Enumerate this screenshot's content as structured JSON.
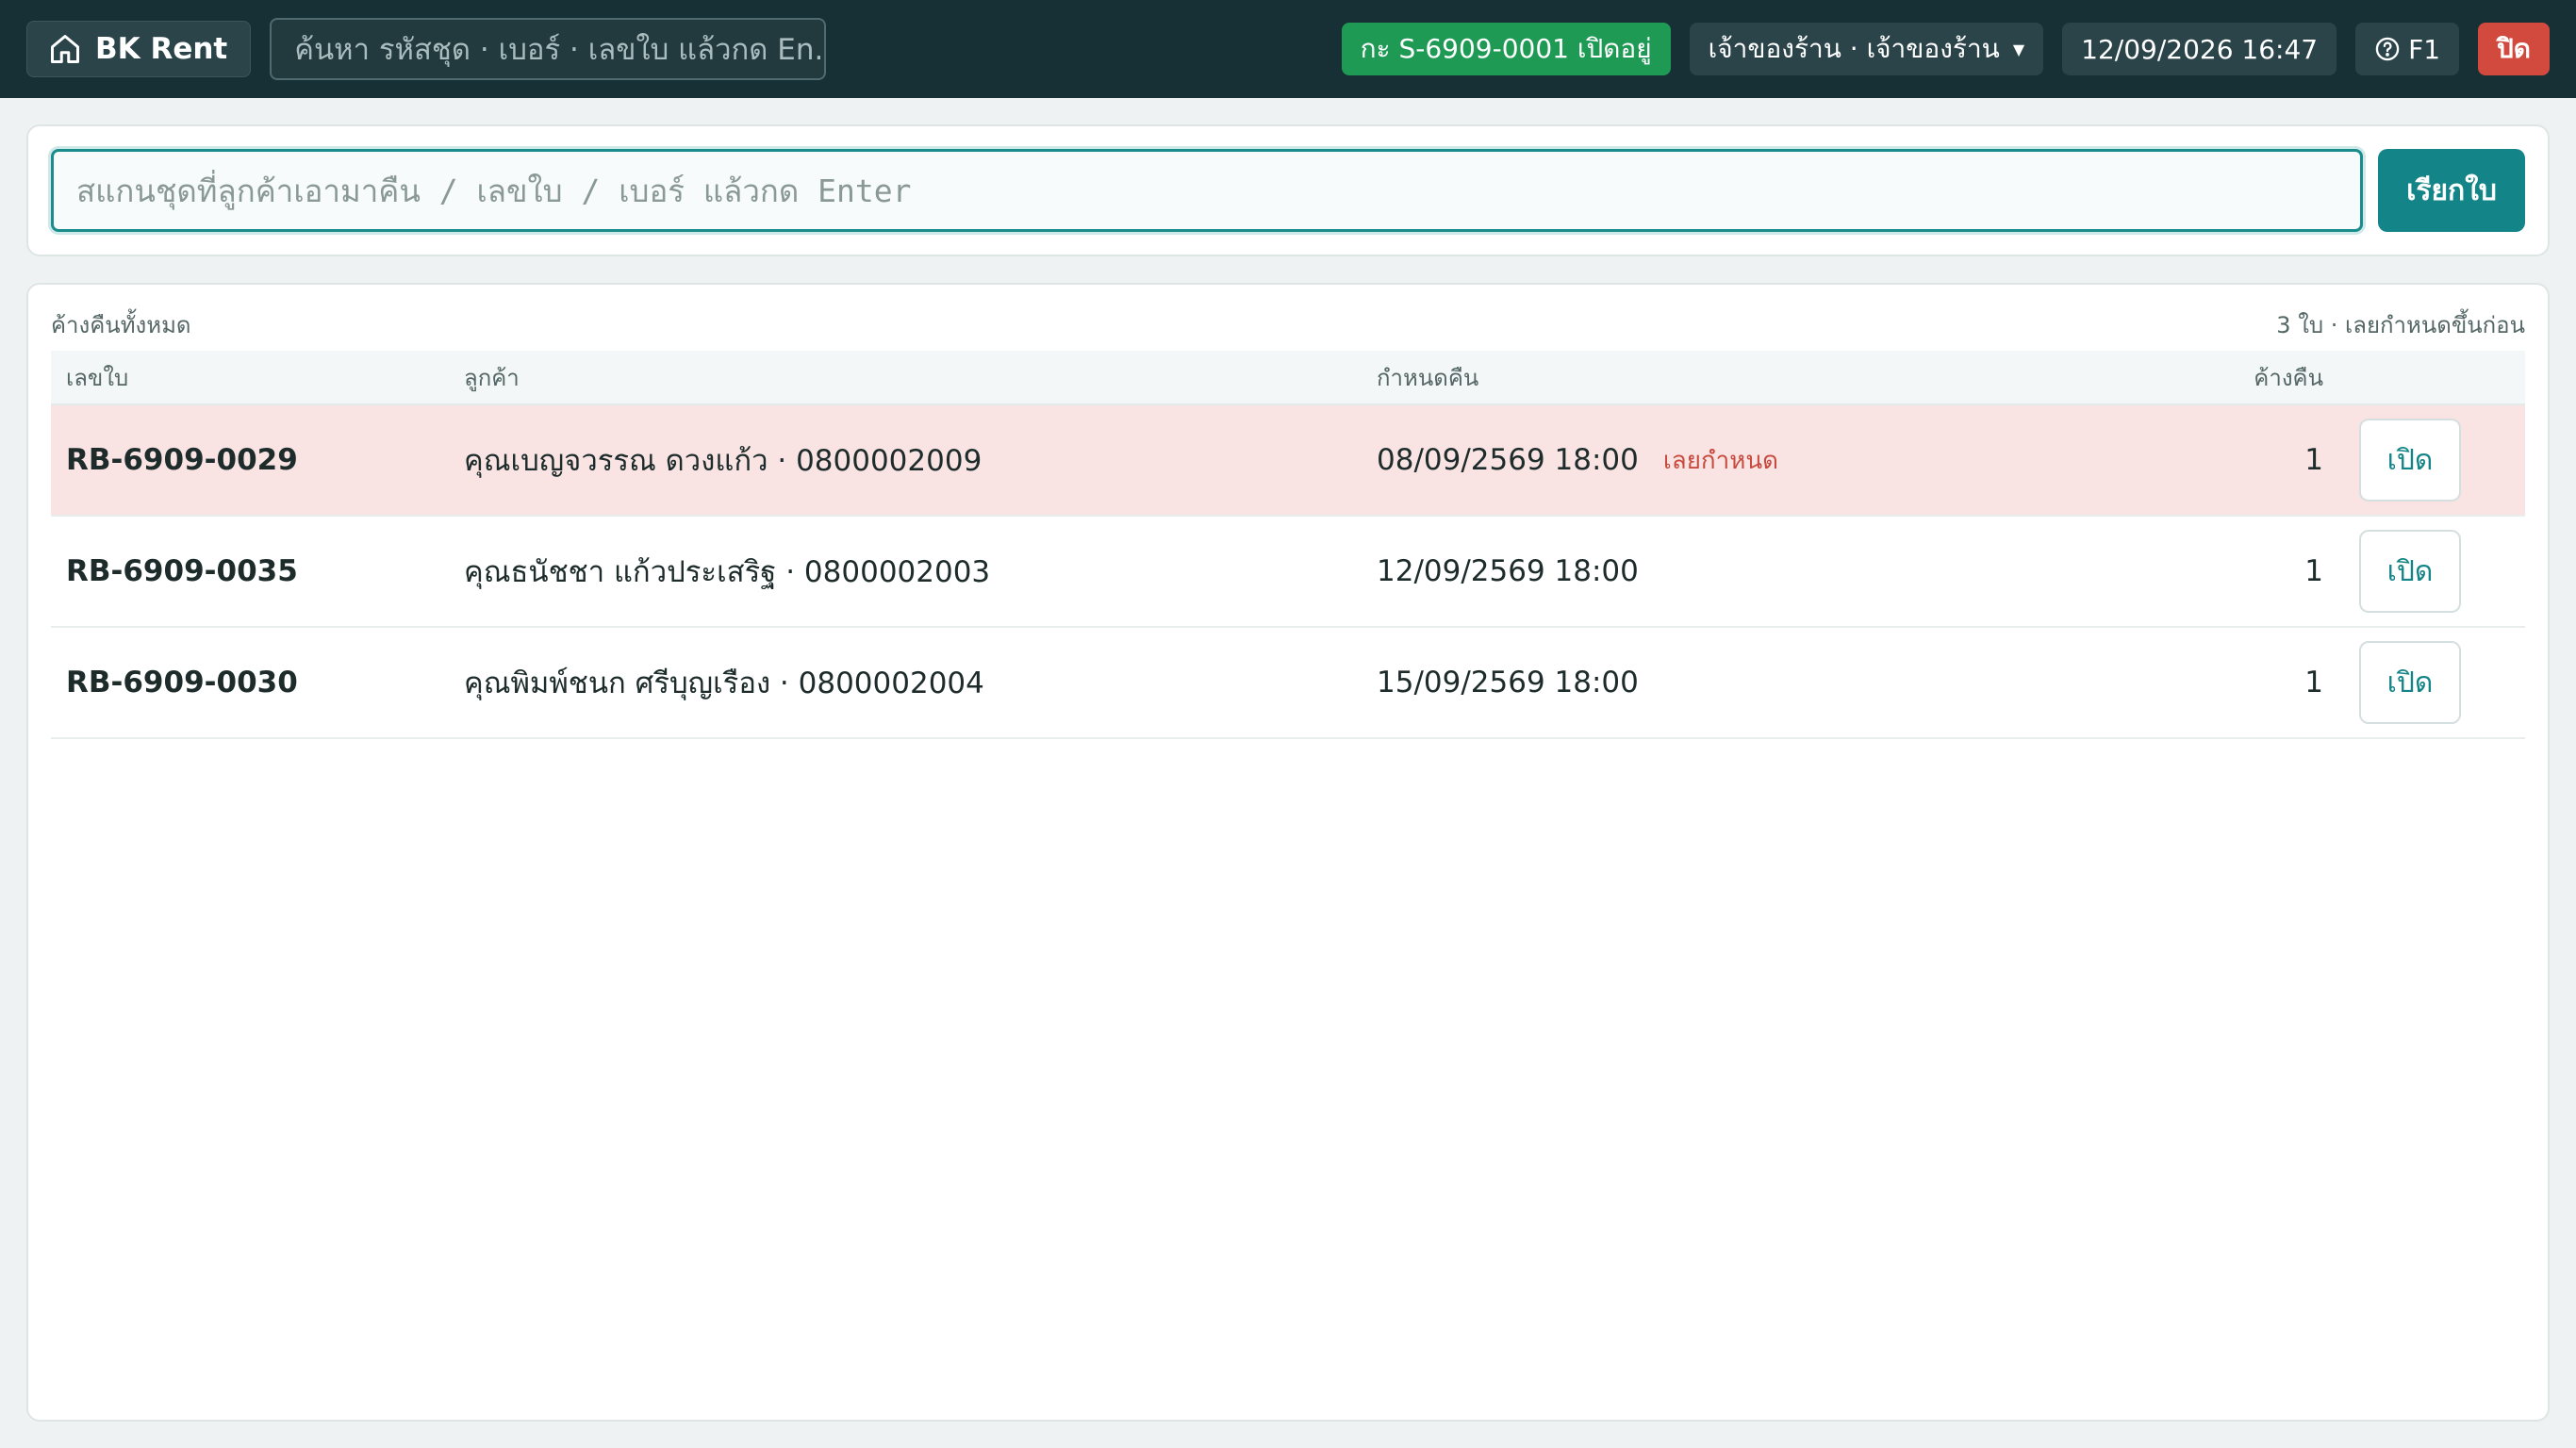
{
  "topbar": {
    "brand": "BK Rent",
    "search_placeholder": "ค้นหา รหัสชุด · เบอร์ · เลขใบ แล้วกด En...",
    "shift_status": "กะ S-6909-0001 เปิดอยู่",
    "user": "เจ้าของร้าน · เจ้าของร้าน",
    "datetime": "12/09/2026 16:47",
    "help": "F1",
    "close": "ปิด"
  },
  "scan": {
    "placeholder": "สแกนชุดที่ลูกค้าเอามาคืน / เลขใบ / เบอร์ แล้วกด Enter",
    "button": "เรียกใบ"
  },
  "list": {
    "title": "ค้างคืนทั้งหมด",
    "summary": "3 ใบ · เลยกำหนดขึ้นก่อน",
    "columns": {
      "number": "เลขใบ",
      "customer": "ลูกค้า",
      "due": "กำหนดคืน",
      "outstanding": "ค้างคืน"
    },
    "rows": [
      {
        "number": "RB-6909-0029",
        "customer": "คุณเบญจวรรณ ดวงแก้ว · 0800002009",
        "due": "08/09/2569 18:00",
        "tag": "เลยกำหนด",
        "count": "1",
        "action": "เปิด"
      },
      {
        "number": "RB-6909-0035",
        "customer": "คุณธนัชชา แก้วประเสริฐ · 0800002003",
        "due": "12/09/2569 18:00",
        "tag": "",
        "count": "1",
        "action": "เปิด"
      },
      {
        "number": "RB-6909-0030",
        "customer": "คุณพิมพ์ชนก ศรีบุญเรือง · 0800002004",
        "due": "15/09/2569 18:00",
        "tag": "",
        "count": "1",
        "action": "เปิด"
      }
    ]
  },
  "icons": {
    "brand": "home-icon",
    "help": "help-circle-icon",
    "caret": "caret-down-icon"
  },
  "colors": {
    "topbar": "#163036",
    "accent": "#138487",
    "shift_open": "#1f9a54",
    "danger": "#d24a3e",
    "overdue_row": "#f9e4e3"
  }
}
